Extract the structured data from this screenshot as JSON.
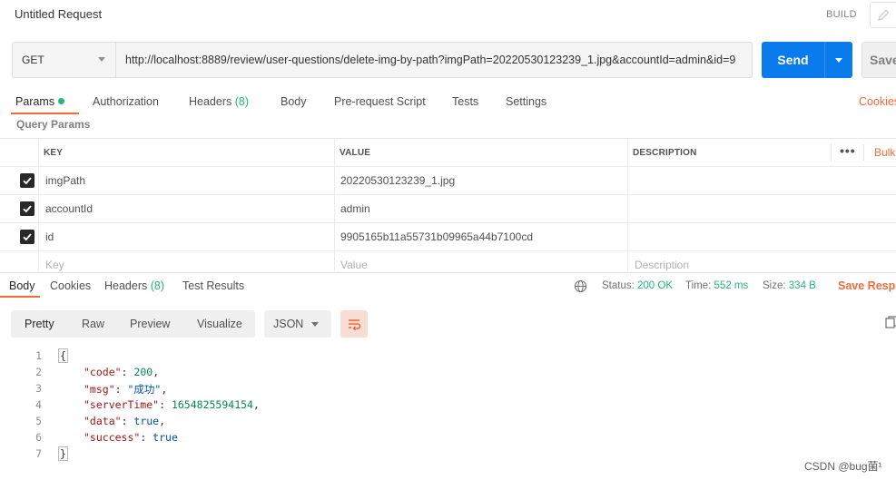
{
  "window": {
    "title": "Untitled Request",
    "build_label": "BUILD"
  },
  "request": {
    "method": "GET",
    "url": "http://localhost:8889/review/user-questions/delete-img-by-path?imgPath=20220530123239_1.jpg&accountId=admin&id=9",
    "send_label": "Send",
    "save_label": "Save"
  },
  "request_tabs": [
    {
      "label": "Params",
      "active": true,
      "has_dot": true
    },
    {
      "label": "Authorization"
    },
    {
      "label": "Headers",
      "count": "(8)"
    },
    {
      "label": "Body"
    },
    {
      "label": "Pre-request Script"
    },
    {
      "label": "Tests"
    },
    {
      "label": "Settings"
    }
  ],
  "cookies_label": "Cookies",
  "query_params": {
    "title": "Query Params",
    "headers": {
      "key": "KEY",
      "value": "VALUE",
      "description": "DESCRIPTION"
    },
    "more_label": "•••",
    "bulk_label": "Bulk",
    "rows": [
      {
        "checked": true,
        "key": "imgPath",
        "value": "20220530123239_1.jpg",
        "description": ""
      },
      {
        "checked": true,
        "key": "accountId",
        "value": "admin",
        "description": ""
      },
      {
        "checked": true,
        "key": "id",
        "value": "9905165b11a55731b09965a44b7100cd",
        "description": ""
      }
    ],
    "placeholders": {
      "key": "Key",
      "value": "Value",
      "description": "Description"
    }
  },
  "response_tabs": [
    {
      "label": "Body",
      "active": true
    },
    {
      "label": "Cookies"
    },
    {
      "label": "Headers",
      "count": "(8)"
    },
    {
      "label": "Test Results"
    }
  ],
  "response_meta": {
    "status_label": "Status:",
    "status_value": "200 OK",
    "time_label": "Time:",
    "time_value": "552 ms",
    "size_label": "Size:",
    "size_value": "334 B",
    "save_response_label": "Save Respo"
  },
  "view_modes": [
    "Pretty",
    "Raw",
    "Preview",
    "Visualize"
  ],
  "format_select": "JSON",
  "response_body": {
    "line_numbers": [
      "1",
      "2",
      "3",
      "4",
      "5",
      "6",
      "7"
    ],
    "open_brace": "{",
    "close_brace": "}",
    "fields": [
      {
        "key": "\"code\"",
        "value": "200",
        "type": "number"
      },
      {
        "key": "\"msg\"",
        "value": "\"成功\"",
        "type": "string"
      },
      {
        "key": "\"serverTime\"",
        "value": "1654825594154",
        "type": "number"
      },
      {
        "key": "\"data\"",
        "value": "true",
        "type": "bool"
      },
      {
        "key": "\"success\"",
        "value": "true",
        "type": "bool",
        "last": true
      }
    ]
  },
  "watermark": "CSDN @bug菌¹",
  "colors": {
    "accent": "#f26b3a",
    "send_blue": "#097bed",
    "ok_green": "#26b47f"
  }
}
